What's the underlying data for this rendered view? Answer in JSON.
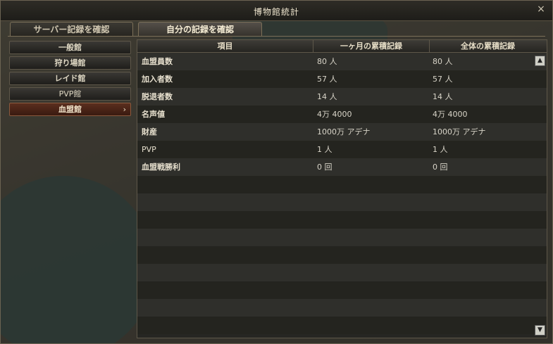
{
  "window": {
    "title": "博物館統計"
  },
  "tabs": [
    {
      "label": "サーバー記録を確認"
    },
    {
      "label": "自分の記録を確認"
    }
  ],
  "categories": [
    {
      "label": "一般館"
    },
    {
      "label": "狩り場館"
    },
    {
      "label": "レイド館"
    },
    {
      "label": "PVP館"
    },
    {
      "label": "血盟館",
      "chevron": "›"
    }
  ],
  "table": {
    "headers": [
      "項目",
      "一ヶ月の累積記録",
      "全体の累積記録"
    ],
    "rows": [
      [
        "血盟員数",
        "80 人",
        "80 人"
      ],
      [
        "加入者数",
        "57 人",
        "57 人"
      ],
      [
        "脱退者数",
        "14 人",
        "14 人"
      ],
      [
        "名声値",
        "4万 4000",
        "4万 4000"
      ],
      [
        "財産",
        "1000万 アデナ",
        "1000万 アデナ"
      ],
      [
        "PVP",
        "1 人",
        "1 人"
      ],
      [
        "血盟戦勝利",
        "0 回",
        "0 回"
      ]
    ]
  },
  "icons": {
    "close": "×",
    "scroll_up": "▲",
    "scroll_down": "▼"
  }
}
